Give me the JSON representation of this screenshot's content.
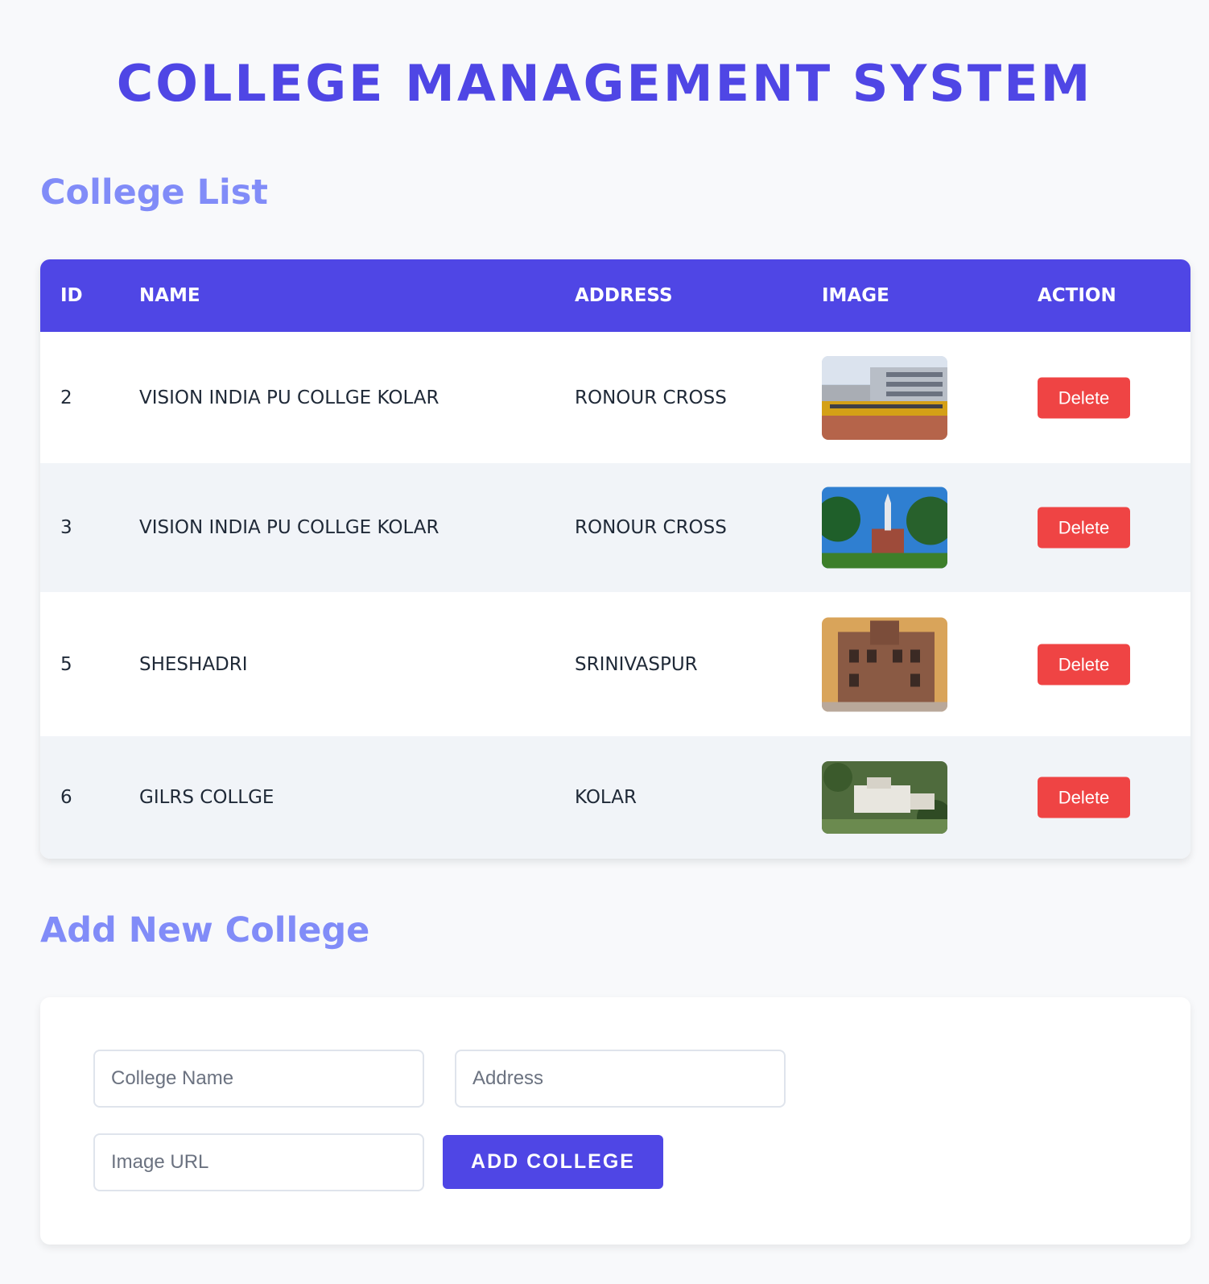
{
  "header": {
    "title": "COLLEGE MANAGEMENT SYSTEM"
  },
  "list_section": {
    "title": "College List"
  },
  "table": {
    "columns": [
      "ID",
      "NAME",
      "ADDRESS",
      "IMAGE",
      "ACTION"
    ],
    "rows": [
      {
        "id": "2",
        "name": "VISION INDIA PU COLLGE KOLAR",
        "address": "RONOUR CROSS",
        "image": "campus-with-buses-photo",
        "action": "Delete"
      },
      {
        "id": "3",
        "name": "VISION INDIA PU COLLGE KOLAR",
        "address": "RONOUR CROSS",
        "image": "clock-tower-hall-photo",
        "action": "Delete"
      },
      {
        "id": "5",
        "name": "SHESHADRI",
        "address": "SRINIVASPUR",
        "image": "gothic-stone-building-photo",
        "action": "Delete"
      },
      {
        "id": "6",
        "name": "GILRS COLLGE",
        "address": "KOLAR",
        "image": "aerial-campus-photo",
        "action": "Delete"
      }
    ]
  },
  "add_section": {
    "title": "Add New College"
  },
  "form": {
    "name_placeholder": "College Name",
    "address_placeholder": "Address",
    "image_placeholder": "Image URL",
    "submit_label": "ADD COLLEGE"
  },
  "colors": {
    "accent": "#4f46e5",
    "section_title": "#818cf8",
    "delete": "#ef4444",
    "row_alt": "#f1f4f8"
  }
}
